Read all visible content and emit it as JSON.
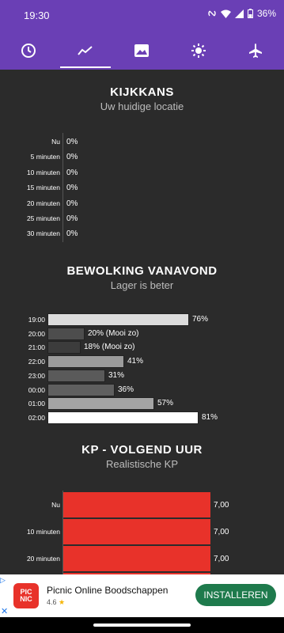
{
  "status": {
    "time": "19:30",
    "battery": "36%"
  },
  "tabs": [
    {
      "icon": "clock-icon"
    },
    {
      "icon": "trend-icon",
      "active": true
    },
    {
      "icon": "image-icon"
    },
    {
      "icon": "sun-icon"
    },
    {
      "icon": "airplane-icon"
    }
  ],
  "kijkkans": {
    "title": "KIJKKANS",
    "subtitle": "Uw huidige locatie",
    "rows": [
      {
        "label": "Nu",
        "value": "0%"
      },
      {
        "label": "5 minuten",
        "value": "0%"
      },
      {
        "label": "10 minuten",
        "value": "0%"
      },
      {
        "label": "15 minuten",
        "value": "0%"
      },
      {
        "label": "20 minuten",
        "value": "0%"
      },
      {
        "label": "25 minuten",
        "value": "0%"
      },
      {
        "label": "30 minuten",
        "value": "0%"
      }
    ]
  },
  "bewolking": {
    "title": "BEWOLKING VANAVOND",
    "subtitle": "Lager is beter",
    "rows": [
      {
        "time": "19:00",
        "value": "76%",
        "pct": 76,
        "color": "#dcdcdc"
      },
      {
        "time": "20:00",
        "value": "20% (Mooi zo)",
        "pct": 20,
        "color": "#4d4d4d"
      },
      {
        "time": "21:00",
        "value": "18% (Mooi zo)",
        "pct": 18,
        "color": "#3c3c3c"
      },
      {
        "time": "22:00",
        "value": "41%",
        "pct": 41,
        "color": "#9b9b9b"
      },
      {
        "time": "23:00",
        "value": "31%",
        "pct": 31,
        "color": "#5a5a5a"
      },
      {
        "time": "00:00",
        "value": "36%",
        "pct": 36,
        "color": "#5f5f5f"
      },
      {
        "time": "01:00",
        "value": "57%",
        "pct": 57,
        "color": "#a4a4a4"
      },
      {
        "time": "02:00",
        "value": "81%",
        "pct": 81,
        "color": "#ffffff"
      }
    ]
  },
  "kp": {
    "title": "KP - VOLGEND UUR",
    "subtitle": "Realistische KP",
    "color": "#e8322a",
    "rows": [
      {
        "label": "Nu",
        "value": "7,00"
      },
      {
        "label": "10 minuten",
        "value": "7,00"
      },
      {
        "label": "20 minuten",
        "value": "7,00"
      }
    ]
  },
  "ad": {
    "logo_line1": "PIC",
    "logo_line2": "NIC",
    "title": "Picnic Online Boodschappen",
    "rating": "4.6",
    "install_label": "INSTALLEREN"
  }
}
